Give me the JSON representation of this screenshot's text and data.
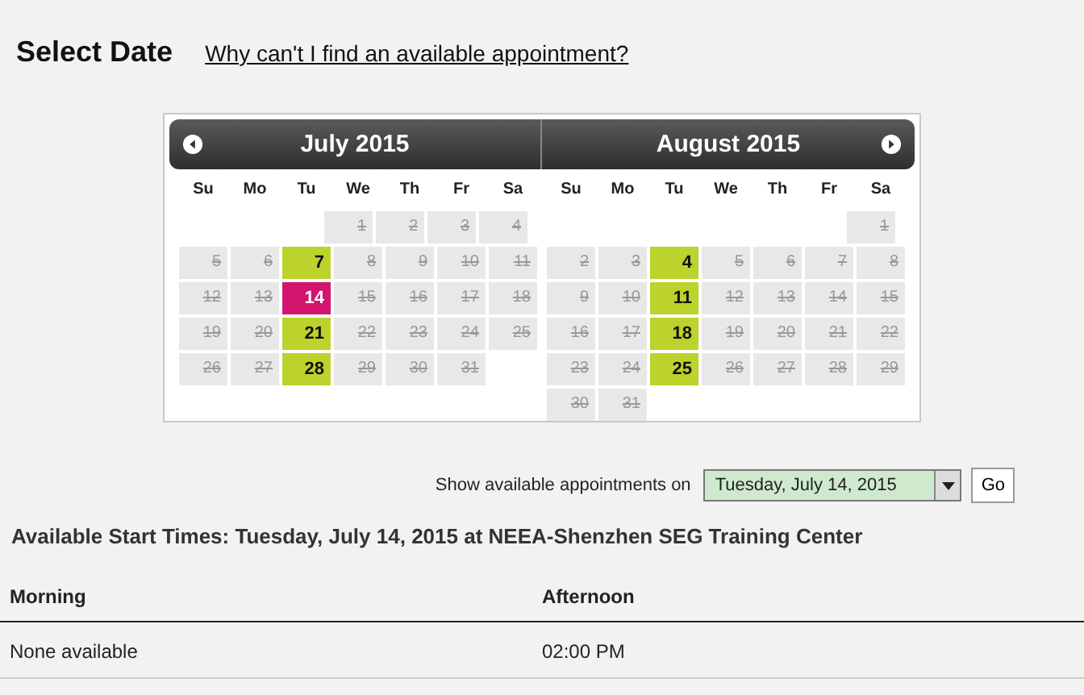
{
  "title": "Select Date",
  "help_link": "Why can't I find an available appointment?",
  "calendar": {
    "months": [
      {
        "name": "July 2015",
        "weekdays": [
          "Su",
          "Mo",
          "Tu",
          "We",
          "Th",
          "Fr",
          "Sa"
        ],
        "weeks": [
          {
            "right_aligned": true,
            "days": [
              {
                "day": "1",
                "available": false,
                "selected": false
              },
              {
                "day": "2",
                "available": false,
                "selected": false
              },
              {
                "day": "3",
                "available": false,
                "selected": false
              },
              {
                "day": "4",
                "available": false,
                "selected": false
              }
            ]
          },
          {
            "right_aligned": false,
            "days": [
              {
                "day": "5",
                "available": false,
                "selected": false
              },
              {
                "day": "6",
                "available": false,
                "selected": false
              },
              {
                "day": "7",
                "available": true,
                "selected": false
              },
              {
                "day": "8",
                "available": false,
                "selected": false
              },
              {
                "day": "9",
                "available": false,
                "selected": false
              },
              {
                "day": "10",
                "available": false,
                "selected": false
              },
              {
                "day": "11",
                "available": false,
                "selected": false
              }
            ]
          },
          {
            "right_aligned": false,
            "days": [
              {
                "day": "12",
                "available": false,
                "selected": false
              },
              {
                "day": "13",
                "available": false,
                "selected": false
              },
              {
                "day": "14",
                "available": true,
                "selected": true
              },
              {
                "day": "15",
                "available": false,
                "selected": false
              },
              {
                "day": "16",
                "available": false,
                "selected": false
              },
              {
                "day": "17",
                "available": false,
                "selected": false
              },
              {
                "day": "18",
                "available": false,
                "selected": false
              }
            ]
          },
          {
            "right_aligned": false,
            "days": [
              {
                "day": "19",
                "available": false,
                "selected": false
              },
              {
                "day": "20",
                "available": false,
                "selected": false
              },
              {
                "day": "21",
                "available": true,
                "selected": false
              },
              {
                "day": "22",
                "available": false,
                "selected": false
              },
              {
                "day": "23",
                "available": false,
                "selected": false
              },
              {
                "day": "24",
                "available": false,
                "selected": false
              },
              {
                "day": "25",
                "available": false,
                "selected": false
              }
            ]
          },
          {
            "right_aligned": false,
            "days": [
              {
                "day": "26",
                "available": false,
                "selected": false
              },
              {
                "day": "27",
                "available": false,
                "selected": false
              },
              {
                "day": "28",
                "available": true,
                "selected": false
              },
              {
                "day": "29",
                "available": false,
                "selected": false
              },
              {
                "day": "30",
                "available": false,
                "selected": false
              },
              {
                "day": "31",
                "available": false,
                "selected": false
              }
            ]
          }
        ]
      },
      {
        "name": "August 2015",
        "weekdays": [
          "Su",
          "Mo",
          "Tu",
          "We",
          "Th",
          "Fr",
          "Sa"
        ],
        "weeks": [
          {
            "right_aligned": true,
            "days": [
              {
                "day": "1",
                "available": false,
                "selected": false
              }
            ]
          },
          {
            "right_aligned": false,
            "days": [
              {
                "day": "2",
                "available": false,
                "selected": false
              },
              {
                "day": "3",
                "available": false,
                "selected": false
              },
              {
                "day": "4",
                "available": true,
                "selected": false
              },
              {
                "day": "5",
                "available": false,
                "selected": false
              },
              {
                "day": "6",
                "available": false,
                "selected": false
              },
              {
                "day": "7",
                "available": false,
                "selected": false
              },
              {
                "day": "8",
                "available": false,
                "selected": false
              }
            ]
          },
          {
            "right_aligned": false,
            "days": [
              {
                "day": "9",
                "available": false,
                "selected": false
              },
              {
                "day": "10",
                "available": false,
                "selected": false
              },
              {
                "day": "11",
                "available": true,
                "selected": false
              },
              {
                "day": "12",
                "available": false,
                "selected": false
              },
              {
                "day": "13",
                "available": false,
                "selected": false
              },
              {
                "day": "14",
                "available": false,
                "selected": false
              },
              {
                "day": "15",
                "available": false,
                "selected": false
              }
            ]
          },
          {
            "right_aligned": false,
            "days": [
              {
                "day": "16",
                "available": false,
                "selected": false
              },
              {
                "day": "17",
                "available": false,
                "selected": false
              },
              {
                "day": "18",
                "available": true,
                "selected": false
              },
              {
                "day": "19",
                "available": false,
                "selected": false
              },
              {
                "day": "20",
                "available": false,
                "selected": false
              },
              {
                "day": "21",
                "available": false,
                "selected": false
              },
              {
                "day": "22",
                "available": false,
                "selected": false
              }
            ]
          },
          {
            "right_aligned": false,
            "days": [
              {
                "day": "23",
                "available": false,
                "selected": false
              },
              {
                "day": "24",
                "available": false,
                "selected": false
              },
              {
                "day": "25",
                "available": true,
                "selected": false
              },
              {
                "day": "26",
                "available": false,
                "selected": false
              },
              {
                "day": "27",
                "available": false,
                "selected": false
              },
              {
                "day": "28",
                "available": false,
                "selected": false
              },
              {
                "day": "29",
                "available": false,
                "selected": false
              }
            ]
          },
          {
            "right_aligned": false,
            "days": [
              {
                "day": "30",
                "available": false,
                "selected": false
              },
              {
                "day": "31",
                "available": false,
                "selected": false
              }
            ]
          }
        ]
      }
    ]
  },
  "date_picker": {
    "label": "Show available appointments on",
    "value": "Tuesday, July 14, 2015",
    "button": "Go"
  },
  "times": {
    "heading": "Available Start Times: Tuesday, July 14, 2015 at NEEA-Shenzhen SEG Training Center",
    "columns": [
      "Morning",
      "Afternoon"
    ],
    "rows": [
      [
        "None available",
        "02:00 PM"
      ]
    ]
  }
}
